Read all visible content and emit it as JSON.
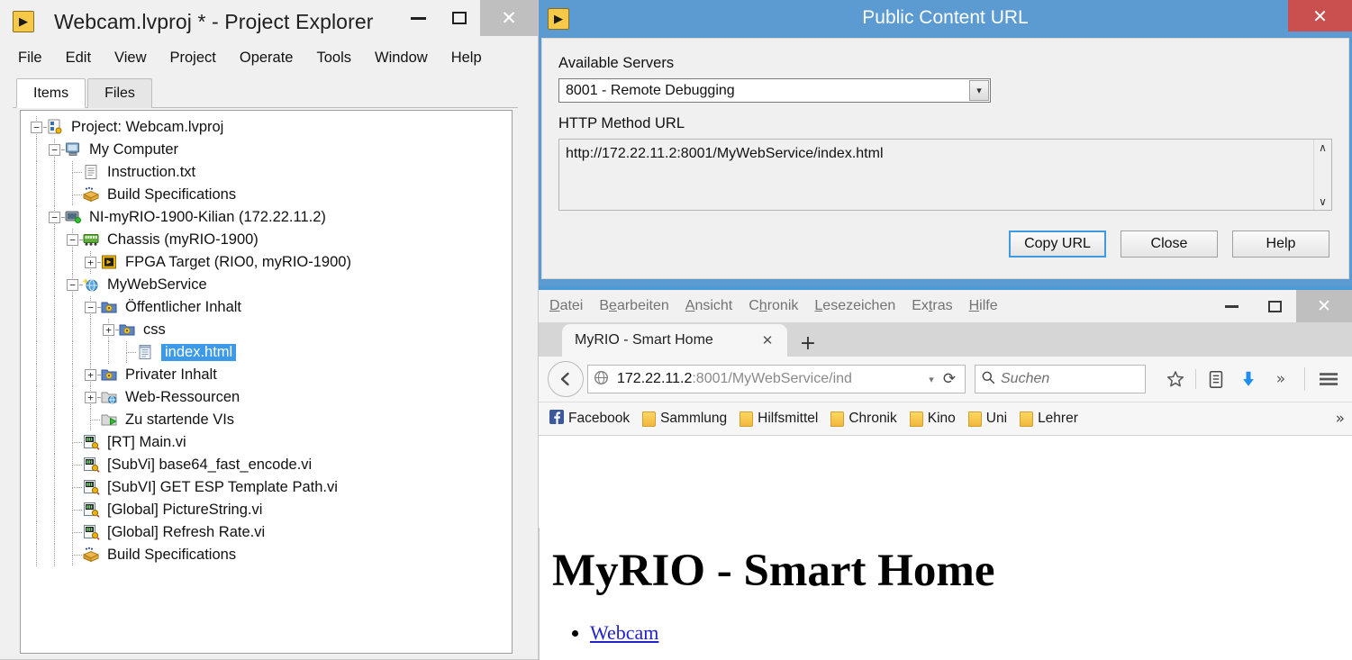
{
  "labview": {
    "title": "Webcam.lvproj * - Project Explorer",
    "app_icon": "labview-icon",
    "window_controls": {
      "minimize": "–",
      "maximize": "□",
      "close": "✕"
    },
    "menu": [
      "File",
      "Edit",
      "View",
      "Project",
      "Operate",
      "Tools",
      "Window",
      "Help"
    ],
    "tabs": [
      {
        "label": "Items",
        "active": true
      },
      {
        "label": "Files",
        "active": false
      }
    ],
    "tree": [
      {
        "label": "Project: Webcam.lvproj",
        "depth": 0,
        "expander": "minus",
        "icon": "project-icon",
        "selected": false
      },
      {
        "label": "My Computer",
        "depth": 1,
        "expander": "minus",
        "icon": "computer-icon",
        "selected": false
      },
      {
        "label": "Instruction.txt",
        "depth": 2,
        "expander": "none",
        "icon": "text-file-icon",
        "selected": false
      },
      {
        "label": "Build Specifications",
        "depth": 2,
        "expander": "none",
        "icon": "build-spec-icon",
        "selected": false
      },
      {
        "label": "NI-myRIO-1900-Kilian (172.22.11.2)",
        "depth": 1,
        "expander": "minus",
        "icon": "target-icon",
        "selected": false
      },
      {
        "label": "Chassis (myRIO-1900)",
        "depth": 2,
        "expander": "minus",
        "icon": "chassis-icon",
        "selected": false
      },
      {
        "label": "FPGA Target (RIO0, myRIO-1900)",
        "depth": 3,
        "expander": "plus",
        "icon": "fpga-icon",
        "selected": false
      },
      {
        "label": "MyWebService",
        "depth": 2,
        "expander": "minus",
        "icon": "webservice-icon",
        "selected": false
      },
      {
        "label": "Öffentlicher Inhalt",
        "depth": 3,
        "expander": "minus",
        "icon": "folder-web-icon",
        "selected": false
      },
      {
        "label": "css",
        "depth": 4,
        "expander": "plus",
        "icon": "folder-web-icon",
        "selected": false
      },
      {
        "label": "index.html",
        "depth": 5,
        "expander": "none",
        "icon": "html-file-icon",
        "selected": true
      },
      {
        "label": "Privater Inhalt",
        "depth": 3,
        "expander": "plus",
        "icon": "folder-web-icon",
        "selected": false
      },
      {
        "label": "Web-Ressourcen",
        "depth": 3,
        "expander": "plus",
        "icon": "folder-globe-icon",
        "selected": false
      },
      {
        "label": "Zu startende VIs",
        "depth": 3,
        "expander": "none",
        "icon": "folder-run-icon",
        "selected": false
      },
      {
        "label": "[RT] Main.vi",
        "depth": 2,
        "expander": "none",
        "icon": "vi-icon",
        "selected": false
      },
      {
        "label": "[SubVi] base64_fast_encode.vi",
        "depth": 2,
        "expander": "none",
        "icon": "vi-icon",
        "selected": false
      },
      {
        "label": "[SubVI] GET ESP Template Path.vi",
        "depth": 2,
        "expander": "none",
        "icon": "vi-icon",
        "selected": false
      },
      {
        "label": "[Global] PictureString.vi",
        "depth": 2,
        "expander": "none",
        "icon": "vi-icon",
        "selected": false
      },
      {
        "label": "[Global] Refresh Rate.vi",
        "depth": 2,
        "expander": "none",
        "icon": "vi-icon",
        "selected": false
      },
      {
        "label": "Build Specifications",
        "depth": 2,
        "expander": "none",
        "icon": "build-spec-icon",
        "selected": false
      }
    ]
  },
  "dialog": {
    "title": "Public Content URL",
    "app_icon": "labview-icon",
    "close_label": "✕",
    "servers_label": "Available Servers",
    "server_selected": "8001 - Remote Debugging",
    "server_arrow": "▾",
    "url_label": "HTTP Method URL",
    "url_value": "http://172.22.11.2:8001/MyWebService/index.html",
    "scroll_up": "∧",
    "scroll_down": "∨",
    "buttons": [
      {
        "label": "Copy URL",
        "focused": true
      },
      {
        "label": "Close",
        "focused": false
      },
      {
        "label": "Help",
        "focused": false
      }
    ],
    "titlebar_color": "#5b9bd1",
    "close_color": "#c9504f"
  },
  "firefox": {
    "menu": [
      {
        "label": "Datei",
        "accel_index": 0
      },
      {
        "label": "Bearbeiten",
        "accel_index": 1
      },
      {
        "label": "Ansicht",
        "accel_index": 0
      },
      {
        "label": "Chronik",
        "accel_index": 1
      },
      {
        "label": "Lesezeichen",
        "accel_index": 1
      },
      {
        "label": "Extras",
        "accel_index": 2
      },
      {
        "label": "Hilfe",
        "accel_index": 1
      }
    ],
    "window_controls": {
      "minimize": "–",
      "maximize": "□",
      "close": "✕"
    },
    "tab": {
      "title": "MyRIO - Smart Home",
      "close_label": "✕"
    },
    "new_tab_label": "+",
    "url_host": "172.22.11.2",
    "url_rest": ":8001/MyWebService/ind",
    "url_dropdown": "▾",
    "reload_label": "⟳",
    "search_placeholder": "Suchen",
    "nav_icons": [
      "bookmark-star-icon",
      "library-icon",
      "downloads-icon",
      "overflow-chevrons-icon",
      "hamburger-menu-icon"
    ],
    "overflow_label": "»",
    "bookmarks": [
      {
        "label": "Facebook",
        "icon": "facebook-icon"
      },
      {
        "label": "Sammlung",
        "icon": "folder-icon"
      },
      {
        "label": "Hilfsmittel",
        "icon": "folder-icon"
      },
      {
        "label": "Chronik",
        "icon": "folder-icon"
      },
      {
        "label": "Kino",
        "icon": "folder-icon"
      },
      {
        "label": "Uni",
        "icon": "folder-icon"
      },
      {
        "label": "Lehrer",
        "icon": "folder-icon"
      }
    ],
    "bookmarks_overflow": "»",
    "page": {
      "heading": "MyRIO - Smart Home",
      "links": [
        "Webcam"
      ]
    }
  }
}
